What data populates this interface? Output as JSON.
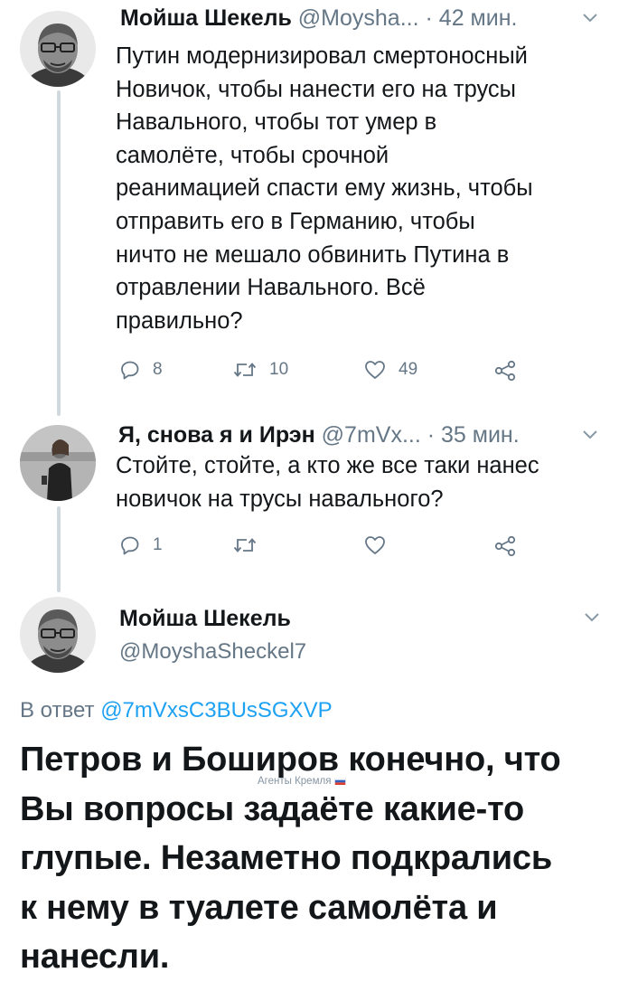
{
  "tweet1": {
    "name": "Мойша Шекель",
    "handle": "@Moysha...",
    "dot": "·",
    "time": "42 мин.",
    "lines": [
      "Путин модернизировал смертоносный",
      "Новичок, чтобы нанести его на трусы",
      "Навального, чтобы тот умер в",
      "самолёте, чтобы срочной",
      "реанимацией спасти ему жизнь, чтобы",
      "отправить его в Германию, чтобы",
      "ничто не мешало обвинить Путина в",
      "отравлении Навального. Всё",
      "правильно?"
    ],
    "replies": "8",
    "retweets": "10",
    "likes": "49"
  },
  "tweet2": {
    "name": "Я, снова я и Ирэн",
    "handle": "@7mVx...",
    "dot": "·",
    "time": "35 мин.",
    "lines": [
      "Стойте, стойте, а кто же все таки нанес",
      "новичок на трусы навального?"
    ],
    "replies": "1"
  },
  "main": {
    "name": "Мойша Шекель",
    "handle": "@MoyshaSheckel7",
    "reply_prefix": "В ответ",
    "reply_mention": "@7mVxsC3BUsSGXVP",
    "lines": [
      "Петров и Боширов конечно, что",
      "Вы вопросы задаёте какие-то",
      "глупые. Незаметно подкрались",
      "к нему в туалете самолёта и",
      "нанесли."
    ]
  },
  "watermark": "Агенты Кремля",
  "icons": {
    "reply": "reply-icon",
    "retweet": "retweet-icon",
    "like": "heart-icon",
    "share": "share-icon",
    "more": "chevron-down-icon"
  },
  "colors": {
    "text": "#14171a",
    "secondary": "#657786",
    "link": "#1da1f2",
    "thread_line": "#cfd9de"
  }
}
